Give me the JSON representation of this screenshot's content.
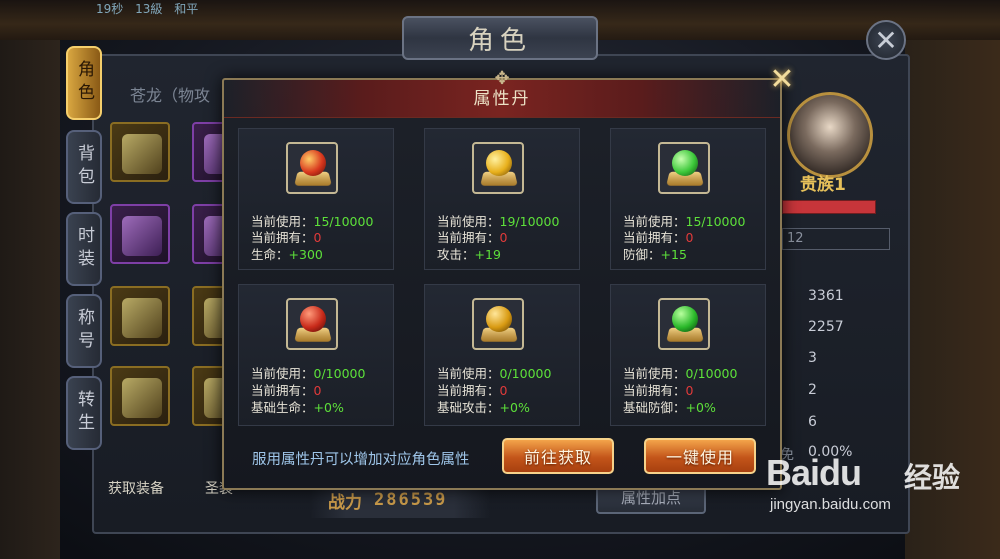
{
  "background": {
    "top_left_text": [
      "19秒",
      "13級",
      "和平"
    ]
  },
  "character_window": {
    "title": "角色",
    "close_icon": "close-icon",
    "subtitle": "苍龙（物攻",
    "side_tabs": [
      "角色",
      "背包",
      "时装",
      "称号",
      "转生"
    ],
    "acquire_label": "获取装备",
    "sage_label": "圣装",
    "power_label": "战力",
    "power_value": "286539",
    "attr_add_button": "属性加点",
    "noble_label": "贵族1",
    "level_box": "12",
    "stats": [
      "3361",
      "2257",
      "3",
      "2",
      "6"
    ],
    "stat_pct_prefix": "免",
    "stat_pct": "0.00%"
  },
  "modal": {
    "title": "属性丹",
    "close_icon": "sparkle-close-icon",
    "hint": "服用属性丹可以增加对应角色属性",
    "buttons": {
      "go_get": "前往获取",
      "use_all": "一键使用"
    },
    "pills": [
      {
        "icon": "red-swirl-pill-icon",
        "used_label": "当前使用：",
        "used_value": "15/10000",
        "owned_label": "当前拥有：",
        "owned_value": "0",
        "attr_label": "生命：",
        "attr_value": "+300",
        "color": "#d8381e"
      },
      {
        "icon": "gold-swirl-pill-icon",
        "used_label": "当前使用：",
        "used_value": "19/10000",
        "owned_label": "当前拥有：",
        "owned_value": "0",
        "attr_label": "攻击：",
        "attr_value": "+19",
        "color": "#e8b01c"
      },
      {
        "icon": "green-swirl-pill-icon",
        "used_label": "当前使用：",
        "used_value": "15/10000",
        "owned_label": "当前拥有：",
        "owned_value": "0",
        "attr_label": "防御：",
        "attr_value": "+15",
        "color": "#3cc83a"
      },
      {
        "icon": "red-orb-pill-icon",
        "used_label": "当前使用：",
        "used_value": "0/10000",
        "owned_label": "当前拥有：",
        "owned_value": "0",
        "attr_label": "基础生命：",
        "attr_value": "+0%",
        "color": "#c82a1a"
      },
      {
        "icon": "gold-orb-pill-icon",
        "used_label": "当前使用：",
        "used_value": "0/10000",
        "owned_label": "当前拥有：",
        "owned_value": "0",
        "attr_label": "基础攻击：",
        "attr_value": "+0%",
        "color": "#d89a12"
      },
      {
        "icon": "green-orb-pill-icon",
        "used_label": "当前使用：",
        "used_value": "0/10000",
        "owned_label": "当前拥有：",
        "owned_value": "0",
        "attr_label": "基础防御：",
        "attr_value": "+0%",
        "color": "#2ab82a"
      }
    ]
  },
  "watermark": {
    "logo": "Baidu",
    "cn": "经验",
    "url": "jingyan.baidu.com"
  }
}
